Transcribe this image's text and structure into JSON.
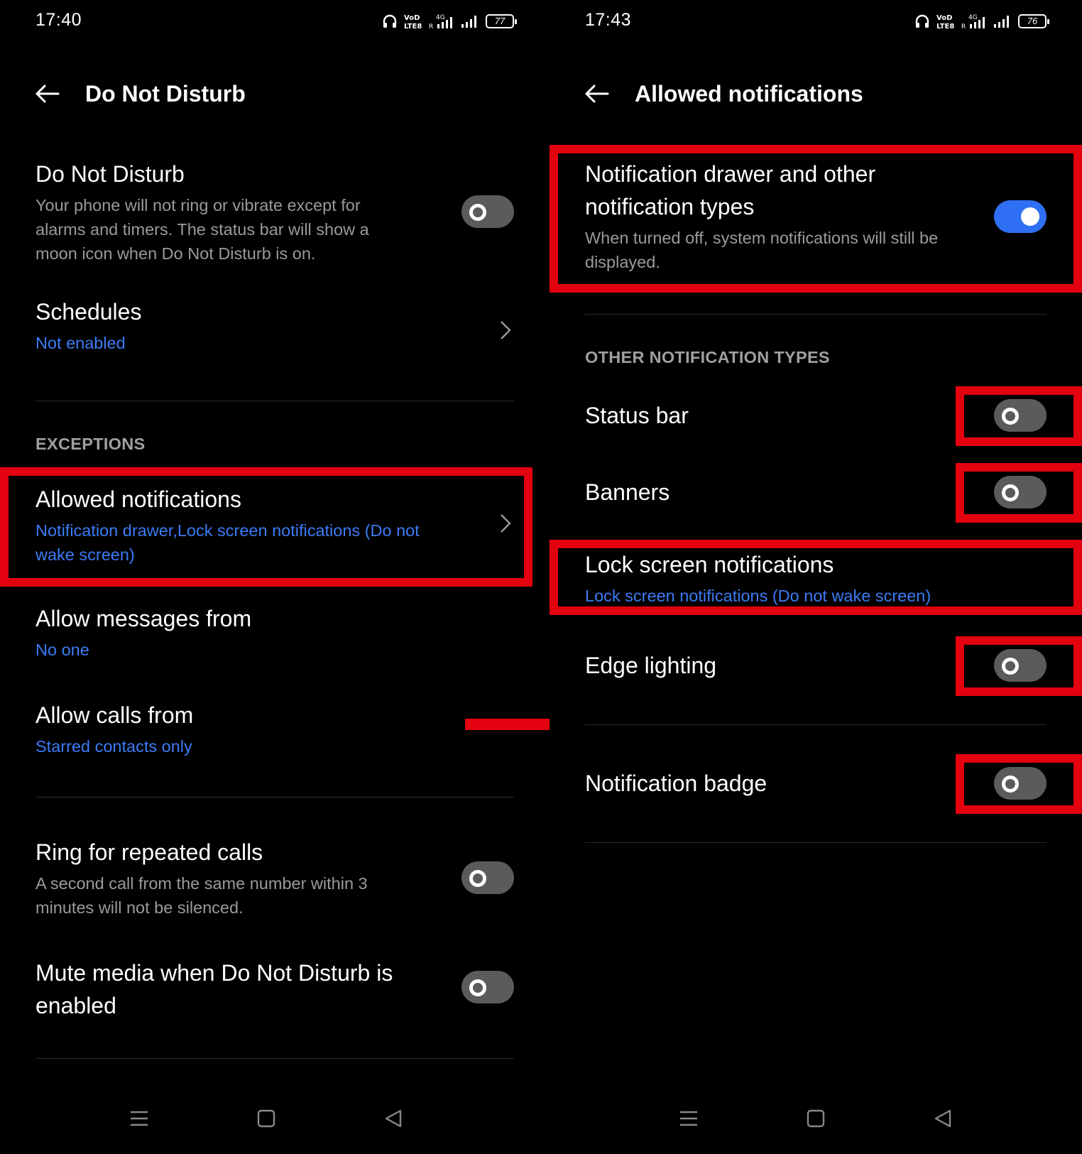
{
  "left": {
    "status_time": "17:40",
    "battery": "77",
    "title": "Do Not Disturb",
    "dnd": {
      "title": "Do Not Disturb",
      "desc": "Your phone will not ring or vibrate except for alarms and timers. The status bar will show a moon icon when Do Not Disturb is on.",
      "on": false
    },
    "schedules": {
      "title": "Schedules",
      "sub": "Not enabled"
    },
    "exceptions_header": "EXCEPTIONS",
    "allowed": {
      "title": "Allowed notifications",
      "sub": "Notification drawer,Lock screen notifications (Do not wake screen)"
    },
    "messages": {
      "title": "Allow messages from",
      "sub": "No one"
    },
    "calls": {
      "title": "Allow calls from",
      "sub": "Starred contacts only"
    },
    "repeated": {
      "title": "Ring for repeated calls",
      "desc": "A second call from the same number within 3 minutes will not be silenced.",
      "on": false
    },
    "mute": {
      "title": "Mute media when Do Not Disturb is enabled",
      "on": false
    }
  },
  "right": {
    "status_time": "17:43",
    "battery": "76",
    "title": "Allowed notifications",
    "drawer": {
      "title": "Notification drawer and other notification types",
      "desc": "When turned off, system notifications will still be displayed.",
      "on": true
    },
    "other_header": "OTHER NOTIFICATION TYPES",
    "status_bar": {
      "title": "Status bar",
      "on": false
    },
    "banners": {
      "title": "Banners",
      "on": false
    },
    "lock_screen": {
      "title": "Lock screen notifications",
      "sub": "Lock screen notifications (Do not wake screen)"
    },
    "edge_lighting": {
      "title": "Edge lighting",
      "on": false
    },
    "badge": {
      "title": "Notification badge",
      "on": false
    }
  },
  "colors": {
    "accent": "#3d7bf5",
    "toggle_on": "#2f6ff4",
    "highlight": "#e3000f"
  }
}
